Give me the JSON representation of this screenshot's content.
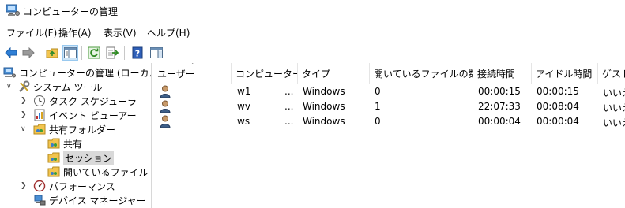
{
  "window": {
    "title": "コンピューターの管理"
  },
  "menu": [
    {
      "label": "ファイル(F)"
    },
    {
      "label": "操作(A)"
    },
    {
      "label": "表示(V)"
    },
    {
      "label": "ヘルプ(H)"
    }
  ],
  "tree": {
    "root": "コンピューターの管理 (ローカル)",
    "system_tools": "システム ツール",
    "task_scheduler": "タスク スケジューラ",
    "event_viewer": "イベント ビューアー",
    "shared_folders": "共有フォルダー",
    "shares": "共有",
    "sessions": "セッション",
    "open_files": "開いているファイル",
    "performance": "パフォーマンス",
    "device_manager": "デバイス マネージャー"
  },
  "columns": [
    {
      "label": "ユーザー"
    },
    {
      "label": "コンピューター"
    },
    {
      "label": "タイプ"
    },
    {
      "label": "開いているファイルの数"
    },
    {
      "label": "接続時間"
    },
    {
      "label": "アイドル時間"
    },
    {
      "label": "ゲスト"
    }
  ],
  "sessions": [
    {
      "user": "",
      "computer": "w1",
      "more": "...",
      "type": "Windows",
      "open_files": "0",
      "connected": "00:00:15",
      "idle": "00:00:15",
      "guest": "いいえ"
    },
    {
      "user": "",
      "computer": "wv",
      "more": "...",
      "type": "Windows",
      "open_files": "1",
      "connected": "22:07:33",
      "idle": "00:08:04",
      "guest": "いいえ"
    },
    {
      "user": "",
      "computer": "ws",
      "more": "...",
      "type": "Windows",
      "open_files": "0",
      "connected": "00:00:04",
      "idle": "00:00:04",
      "guest": "いいえ"
    }
  ],
  "colors": {
    "accent": "#1e73c8",
    "selection": "#d9d9d9",
    "toolbar_active": "#cce4f7"
  }
}
